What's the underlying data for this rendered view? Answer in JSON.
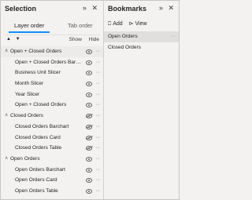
{
  "selection": {
    "title": "Selection",
    "header_icons": "»✕",
    "tabs": [
      {
        "label": "Layer order",
        "active": true
      },
      {
        "label": "Tab order",
        "active": false
      }
    ],
    "up_arrow": "▲",
    "down_arrow": "▼",
    "show_label": "Show",
    "hide_label": "Hide",
    "rows": [
      {
        "label": "Open + Closed Orders",
        "group": true,
        "expanded": true,
        "visible": true,
        "highlighted": true
      },
      {
        "label": "Open + Closed Orders Barch...",
        "group": false,
        "visible": true
      },
      {
        "label": "Business Unit Slicer",
        "group": false,
        "visible": true
      },
      {
        "label": "Month Slicer",
        "group": false,
        "visible": true
      },
      {
        "label": "Year Slicer",
        "group": false,
        "visible": true
      },
      {
        "label": "Open + Closed Orders",
        "group": false,
        "visible": true
      },
      {
        "label": "Closed Orders",
        "group": true,
        "expanded": true,
        "visible": false
      },
      {
        "label": "Closed Orders Barchart",
        "group": false,
        "visible": false
      },
      {
        "label": "Closed Orders Card",
        "group": false,
        "visible": false
      },
      {
        "label": "Closed Orders Table",
        "group": false,
        "visible": false
      },
      {
        "label": "Open Orders",
        "group": true,
        "expanded": true,
        "visible": true
      },
      {
        "label": "Open Orders Barchart",
        "group": false,
        "visible": true
      },
      {
        "label": "Open Orders Card",
        "group": false,
        "visible": true
      },
      {
        "label": "Open Orders Table",
        "group": false,
        "visible": true
      }
    ]
  },
  "bookmarks": {
    "title": "Bookmarks",
    "header_icons": "»✕",
    "add_label": "Add",
    "view_label": "View",
    "items": [
      {
        "label": "Open Orders",
        "selected": true
      },
      {
        "label": "Closed Orders",
        "selected": false
      }
    ]
  },
  "icons": {
    "chevron": "∧",
    "more": "···",
    "add_icon": "⎕",
    "view_icon": "⊳"
  }
}
